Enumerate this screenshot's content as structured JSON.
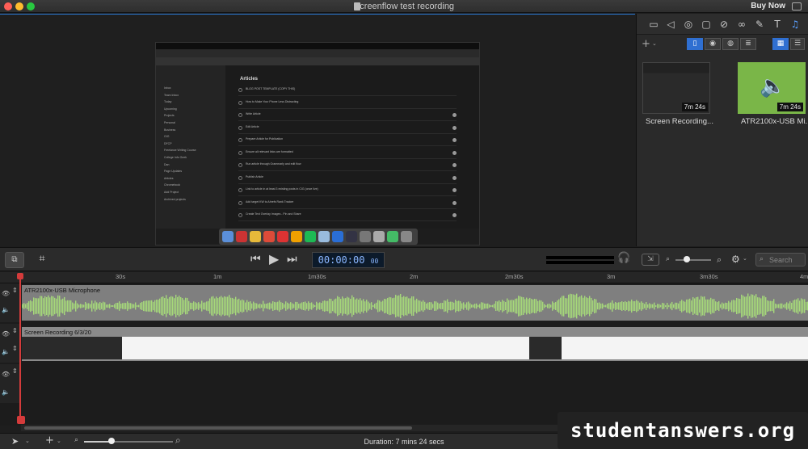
{
  "window": {
    "title": "Screenflow test recording",
    "buy_now": "Buy Now",
    "colors": {
      "close": "#ff5f57",
      "minimize": "#febc2e",
      "zoom": "#28c840",
      "accent": "#2a7bd8"
    }
  },
  "preview": {
    "app_heading": "Articles",
    "sidebar_items": [
      "Inbox",
      "Team Inbox",
      "Today",
      "Upcoming",
      "Projects",
      "Personal",
      "Business",
      "GIG",
      "DFCP",
      "Freelance Writing Course",
      "College Info Geek",
      "Dan",
      "Page Updates",
      "Articles",
      "Chromebook",
      "Add Project",
      "Archived projects"
    ],
    "tasks": [
      "BLOG POST TEMPLATE (COPY THIS)",
      "How to Make Your Phone Less Distracting",
      "Write Article",
      "Edit Article",
      "Prepare Article for Publication",
      "Ensure all relevant links are formatted",
      "Run article through Grammarly and edit flow",
      "Publish Article",
      "Link to article in at least 3 existing posts in CIG (once live)",
      "Add target KW to Ahrefs Rank Tracker",
      "Create Text Overlay Images - Pin and Share"
    ]
  },
  "media_panel": {
    "items": [
      {
        "label": "Screen Recording...",
        "duration": "7m 24s",
        "type": "video"
      },
      {
        "label": "ATR2100x-USB Mi...",
        "duration": "7m 24s",
        "type": "audio"
      }
    ],
    "search_placeholder": "Search",
    "toolbar_icons": [
      "video-properties-icon",
      "audio-properties-icon",
      "screen-recording-icon",
      "callout-icon",
      "touch-callout-icon",
      "annotations-icon",
      "text-icon",
      "media-library-icon"
    ]
  },
  "transport": {
    "timecode_main": "00:00:00",
    "timecode_frames": "00"
  },
  "timeline": {
    "ruler_labels": [
      "30s",
      "1m",
      "1m30s",
      "2m",
      "2m30s",
      "3m",
      "3m30s",
      "4m"
    ],
    "audio_track_label": "ATR2100x-USB Microphone",
    "video_track_label": "Screen Recording 6/3/20"
  },
  "bottom": {
    "duration": "Duration: 7 mins 24 secs"
  },
  "watermark": "studentanswers.org"
}
